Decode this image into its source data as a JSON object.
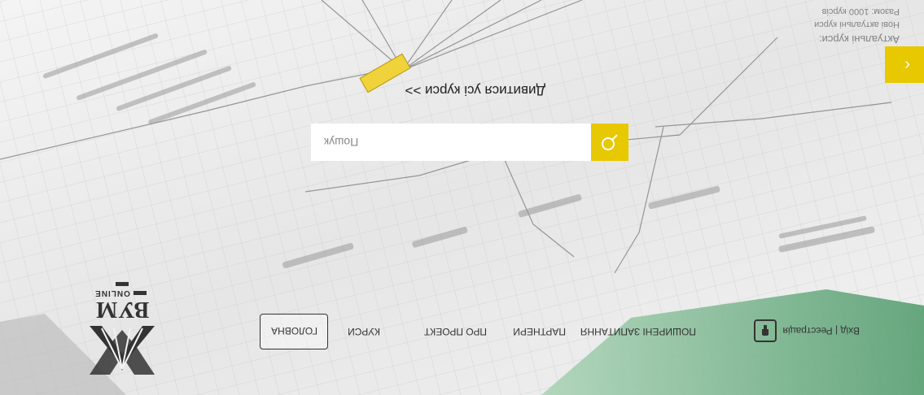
{
  "background": {
    "description": "blurred photo of paper charts / diagrams",
    "text_lines": [
      "Актуальні курси:",
      "Нові актуальні курси",
      "Разом: 1000 курсів"
    ]
  },
  "logo": {
    "word": "ВУМ",
    "sub": "ONLINE"
  },
  "nav": {
    "items": [
      {
        "label": "ГОЛОВНА",
        "active": true
      },
      {
        "label": "КУРСИ"
      },
      {
        "label": "ПРО ПРОЕКТ"
      },
      {
        "label": "ПАРТНЕРИ"
      },
      {
        "label": "ПОШИРЕНІ ЗАПИТАННЯ"
      }
    ]
  },
  "login": {
    "label": "Вхід | Реєстрація",
    "icon": "lock-icon"
  },
  "search": {
    "placeholder": "Пошук",
    "icon": "search-icon"
  },
  "all_courses_link": "Дивитися усі курси >>",
  "side_toggle": {
    "label": "‹",
    "icon": "chevron-left-icon"
  },
  "colors": {
    "accent": "#e8c800",
    "text": "#333333"
  }
}
